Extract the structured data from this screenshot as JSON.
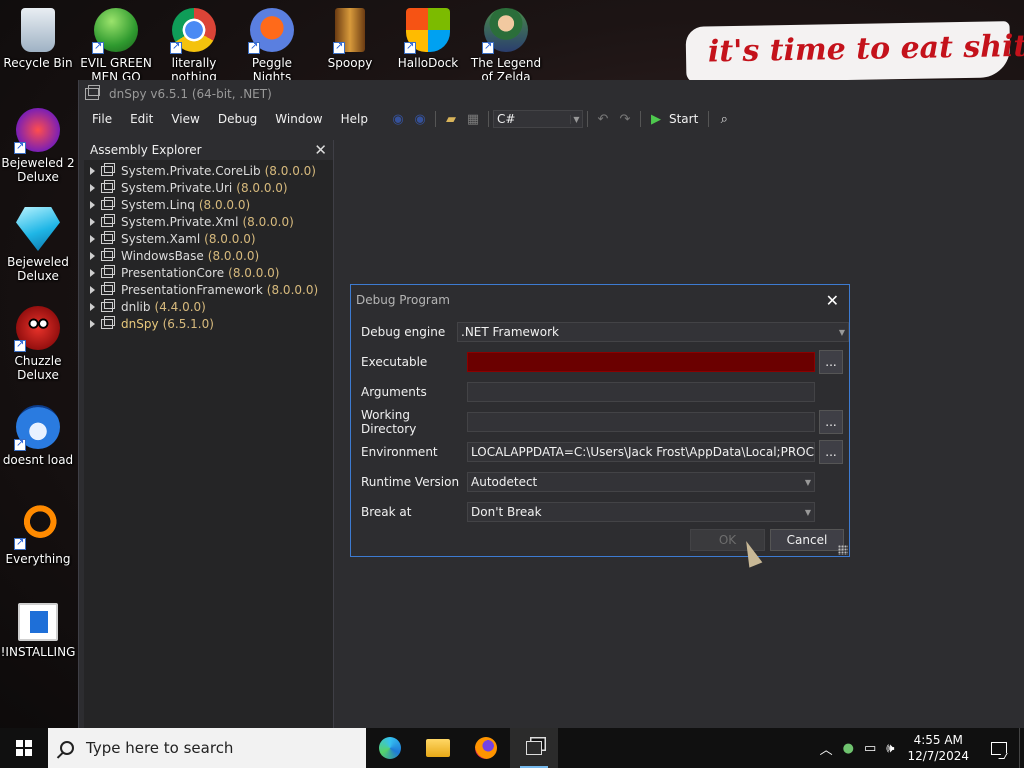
{
  "desktop": {
    "icons": [
      {
        "label": "Recycle Bin"
      },
      {
        "label": "EVIL GREEN MEN GO"
      },
      {
        "label": "literally nothing"
      },
      {
        "label": "Peggle Nights Deluxe"
      },
      {
        "label": "Spoopy"
      },
      {
        "label": "HalloDock"
      },
      {
        "label": "The Legend of Zelda"
      },
      {
        "label": "Bejeweled 2 Deluxe"
      },
      {
        "label": "Bejeweled Deluxe"
      },
      {
        "label": "Chuzzle Deluxe"
      },
      {
        "label": "doesnt load"
      },
      {
        "label": "Everything"
      },
      {
        "label": "!INSTALLING"
      }
    ],
    "wallpaper_text": "it's time to eat shit"
  },
  "window": {
    "title": "dnSpy v6.5.1 (64-bit, .NET)",
    "menu": [
      "File",
      "Edit",
      "View",
      "Debug",
      "Window",
      "Help"
    ],
    "toolbar": {
      "language": "C#",
      "start_label": "Start"
    }
  },
  "assembly_explorer": {
    "title": "Assembly Explorer",
    "items": [
      {
        "name": "System.Private.CoreLib",
        "version": "(8.0.0.0)"
      },
      {
        "name": "System.Private.Uri",
        "version": "(8.0.0.0)"
      },
      {
        "name": "System.Linq",
        "version": "(8.0.0.0)"
      },
      {
        "name": "System.Private.Xml",
        "version": "(8.0.0.0)"
      },
      {
        "name": "System.Xaml",
        "version": "(8.0.0.0)"
      },
      {
        "name": "WindowsBase",
        "version": "(8.0.0.0)"
      },
      {
        "name": "PresentationCore",
        "version": "(8.0.0.0)"
      },
      {
        "name": "PresentationFramework",
        "version": "(8.0.0.0)"
      },
      {
        "name": "dnlib",
        "version": "(4.4.0.0)"
      },
      {
        "name": "dnSpy",
        "version": "(6.5.1.0)"
      }
    ]
  },
  "dialog": {
    "title": "Debug Program",
    "debug_engine_label": "Debug engine",
    "debug_engine_value": ".NET Framework",
    "executable_label": "Executable",
    "executable_value": "",
    "arguments_label": "Arguments",
    "arguments_value": "",
    "working_dir_label": "Working Directory",
    "working_dir_value": "",
    "environment_label": "Environment",
    "environment_value": "LOCALAPPDATA=C:\\Users\\Jack Frost\\AppData\\Local;PROCESSOR_",
    "runtime_label": "Runtime Version",
    "runtime_value": "Autodetect",
    "break_label": "Break at",
    "break_value": "Don't Break",
    "browse_label": "...",
    "ok_label": "OK",
    "cancel_label": "Cancel"
  },
  "taskbar": {
    "search_placeholder": "Type here to search",
    "time": "4:55 AM",
    "date": "12/7/2024"
  },
  "colors": {
    "accent": "#3d7bd1",
    "executable_error": "#6b0000",
    "version_text": "#d7ba7d"
  }
}
